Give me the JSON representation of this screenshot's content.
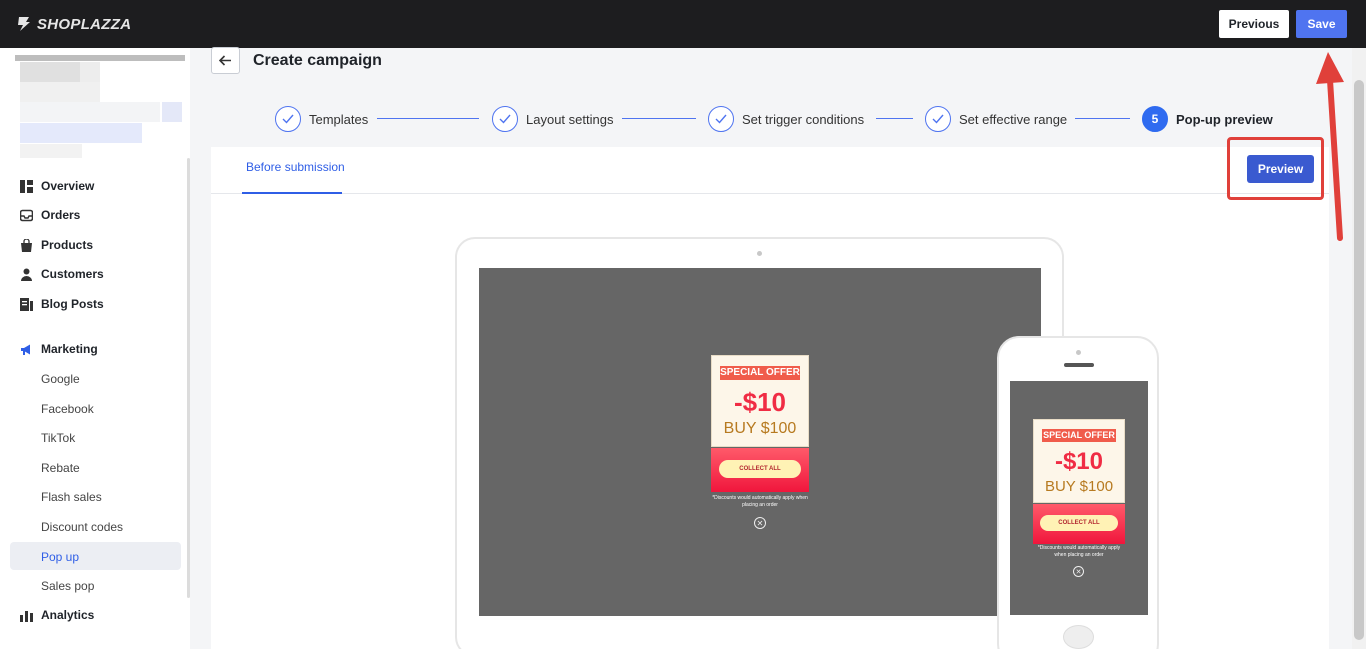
{
  "app": {
    "logo_text": "SHOPLAZZA"
  },
  "topbar": {
    "previous_label": "Previous",
    "save_label": "Save"
  },
  "sidebar": {
    "items": [
      {
        "label": "Overview",
        "icon": "overview-icon"
      },
      {
        "label": "Orders",
        "icon": "inbox-icon"
      },
      {
        "label": "Products",
        "icon": "bag-icon"
      },
      {
        "label": "Customers",
        "icon": "person-icon"
      },
      {
        "label": "Blog Posts",
        "icon": "blog-icon"
      },
      {
        "label": "Marketing",
        "icon": "megaphone-icon"
      }
    ],
    "marketing_sub": [
      "Google",
      "Facebook",
      "TikTok",
      "Rebate",
      "Flash sales",
      "Discount codes",
      "Pop up",
      "Sales pop"
    ],
    "active_sub": "Pop up",
    "analytics": {
      "label": "Analytics",
      "icon": "chart-icon"
    }
  },
  "page": {
    "title": "Create campaign"
  },
  "steps": [
    {
      "label": "Templates",
      "state": "done"
    },
    {
      "label": "Layout settings",
      "state": "done"
    },
    {
      "label": "Set trigger conditions",
      "state": "done"
    },
    {
      "label": "Set effective range",
      "state": "done"
    },
    {
      "label": "Pop-up preview",
      "state": "active",
      "number": "5"
    }
  ],
  "tabs": {
    "active": "Before submission"
  },
  "preview_button": "Preview",
  "coupon": {
    "tag": "SPECIAL OFFER",
    "amount": "-$10",
    "buy": "BUY $100",
    "button": "COLLECT ALL",
    "note": "*Discounts would automatically apply when placing an order"
  },
  "colors": {
    "accent": "#4f74f0",
    "topbar": "#1d1d1f",
    "highlight": "#e0403a"
  }
}
